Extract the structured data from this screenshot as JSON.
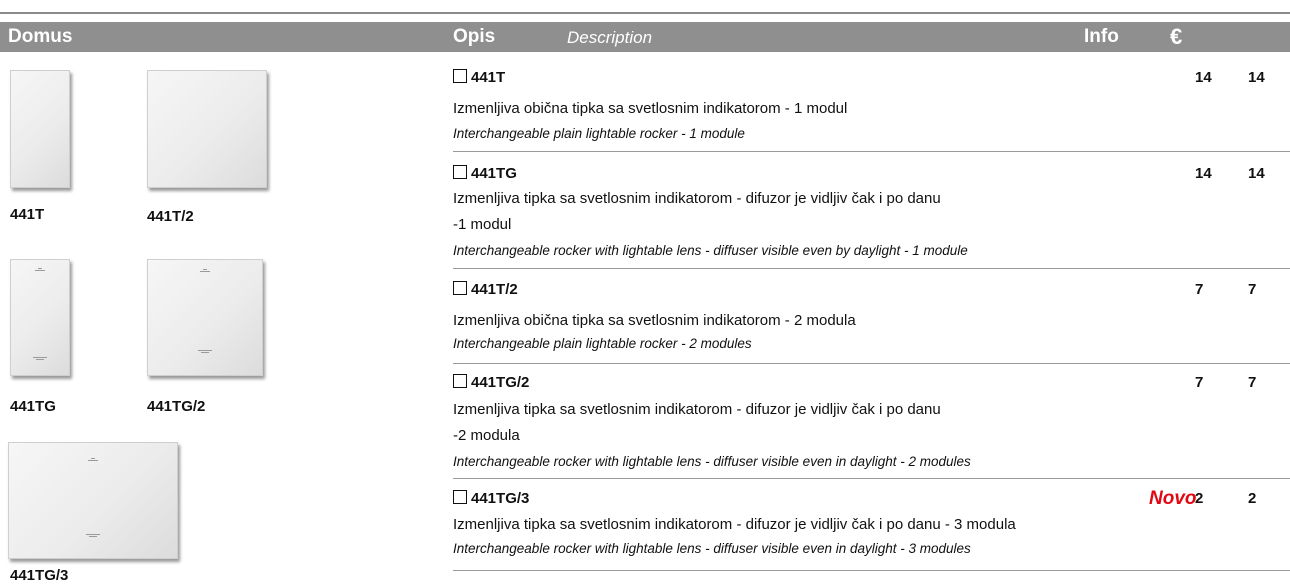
{
  "header": {
    "domus": "Domus",
    "opis": "Opis",
    "description": "Description",
    "info": "Info",
    "currency": "€"
  },
  "products": [
    {
      "label": "441T"
    },
    {
      "label": "441T/2"
    },
    {
      "label": "441TG"
    },
    {
      "label": "441TG/2"
    },
    {
      "label": "441TG/3"
    }
  ],
  "rows": [
    {
      "code": "441T",
      "desc_sr": "Izmenljiva obična tipka sa svetlosnim indikatorom - 1 modul",
      "desc_en": "Interchangeable plain lightable rocker - 1 module",
      "info": "14",
      "price": "14"
    },
    {
      "code": "441TG",
      "desc_sr": "Izmenljiva tipka sa svetlosnim indikatorom - difuzor je vidljiv čak i po danu",
      "desc_sr2": "-1 modul",
      "desc_en": "Interchangeable rocker with lightable lens - diffuser visible even by daylight - 1 module",
      "info": "14",
      "price": "14"
    },
    {
      "code": "441T/2",
      "desc_sr": "Izmenljiva obična tipka sa svetlosnim indikatorom - 2 modula",
      "desc_en": "Interchangeable plain lightable rocker - 2 modules",
      "info": "7",
      "price": "7"
    },
    {
      "code": "441TG/2",
      "desc_sr": "Izmenljiva tipka sa svetlosnim indikatorom - difuzor je vidljiv čak i po danu",
      "desc_sr2": "-2 modula",
      "desc_en": "Interchangeable rocker with lightable lens - diffuser visible even in daylight - 2 modules",
      "info": "7",
      "price": "7"
    },
    {
      "code": "441TG/3",
      "badge": "Novo",
      "desc_sr": "Izmenljiva tipka sa svetlosnim indikatorom - difuzor je vidljiv čak i po danu  - 3 modula",
      "desc_en": "Interchangeable rocker with lightable lens - diffuser visible even in daylight - 3 modules",
      "info": "2",
      "price": "2"
    }
  ]
}
